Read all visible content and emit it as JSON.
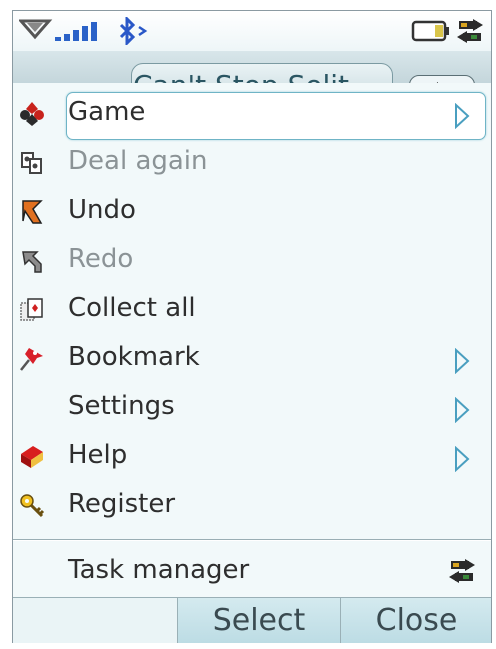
{
  "window": {
    "title": "Can't Stop Solit"
  },
  "menu": {
    "items": [
      {
        "label": "Game",
        "icon": "cards-suits-icon",
        "submenu": true,
        "enabled": true,
        "selected": true
      },
      {
        "label": "Deal again",
        "icon": "deal-cards-icon",
        "submenu": false,
        "enabled": false
      },
      {
        "label": "Undo",
        "icon": "undo-arrow-icon",
        "submenu": false,
        "enabled": true
      },
      {
        "label": "Redo",
        "icon": "redo-arrow-icon",
        "submenu": false,
        "enabled": false
      },
      {
        "label": "Collect all",
        "icon": "card-stack-icon",
        "submenu": false,
        "enabled": true
      },
      {
        "label": "Bookmark",
        "icon": "pushpin-icon",
        "submenu": true,
        "enabled": true
      },
      {
        "label": "Settings",
        "icon": "",
        "submenu": true,
        "enabled": true
      },
      {
        "label": "Help",
        "icon": "help-book-icon",
        "submenu": true,
        "enabled": true
      },
      {
        "label": "Register",
        "icon": "key-icon",
        "submenu": false,
        "enabled": true
      }
    ],
    "task_manager": {
      "label": "Task manager",
      "icon": "task-manager-icon"
    }
  },
  "softkeys": {
    "left": "",
    "select": "Select",
    "close": "Close"
  },
  "colors": {
    "accent": "#6fb4c6",
    "softkey_bg": "#c8e3ea",
    "disabled_text": "#8b9396"
  }
}
